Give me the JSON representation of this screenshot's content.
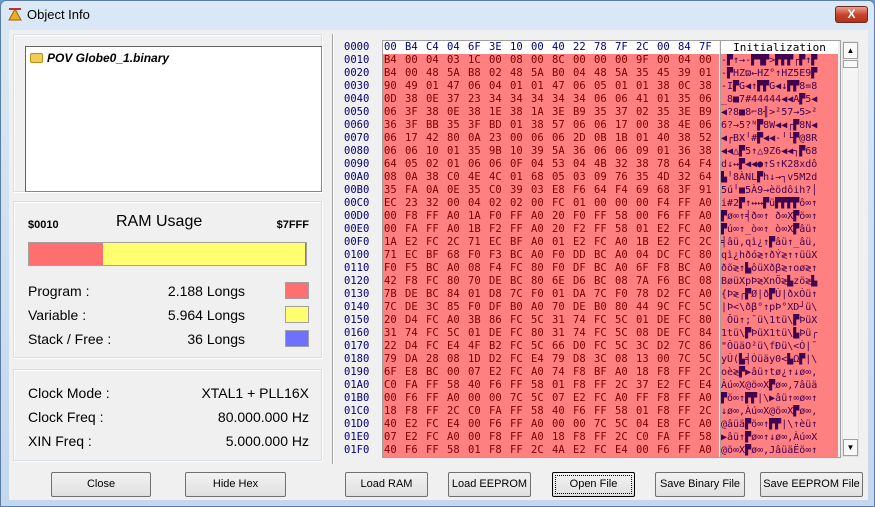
{
  "window": {
    "title": "Object Info",
    "close": "X"
  },
  "tree": {
    "file": "POV Globe0_1.binary"
  },
  "ram": {
    "title": "RAM Usage",
    "start": "$0010",
    "end": "$7FFF",
    "program_label": "Program :",
    "program_value": "2.188 Longs",
    "variable_label": "Variable :",
    "variable_value": "5.964 Longs",
    "stack_label": "Stack / Free :",
    "stack_value": "36 Longs",
    "program_longs": 2188,
    "variable_longs": 5964,
    "stack_longs": 36,
    "colors": {
      "program": "#ff6f6f",
      "variable": "#ffff70",
      "stack": "#7070ff"
    }
  },
  "clock": {
    "mode_label": "Clock Mode :",
    "mode_value": "XTAL1 + PLL16X",
    "freq_label": "Clock Freq :",
    "freq_value": "80.000.000 Hz",
    "xin_label": "XIN Freq :",
    "xin_value": "5.000.000 Hz"
  },
  "hex": {
    "rows": [
      [
        "0000",
        "00 B4 C4 04 6F 3E 10 00 40 22 78 7F 2C 00 84 7F",
        "Initialization"
      ],
      [
        "0010",
        "B4 00 04 03 1C 00 08 00 8C 00 00 00 9F 00 04 00",
        "-▛↑→-▛▜▛>▛▛▛┌▛↑▛"
      ],
      [
        "0020",
        "B4 00 48 5A B8 02 48 5A B0 04 48 5A 35 45 39 01",
        "-▛HZϖ←HZ°↑HZ5E9▛"
      ],
      [
        "0030",
        "90 49 01 47 06 04 01 01 47 06 05 01 01 38 0C 38",
        "-I▛G◀↑▛▛G◀↓▛▛8=8"
      ],
      [
        "0040",
        "0D 38 0E 37 23 34 34 34 34 34 06 06 41 01 35 06",
        "_8■7#44444◀◀A▛5◀"
      ],
      [
        "0050",
        "06 3F 38 0E 38 1E 38 1A 3E B9 35 37 02 35 3E B9",
        "◀?8■8⌐8╢>²57→5>²"
      ],
      [
        "0060",
        "36 3F BB 35 3F BD 01 38 57 06 06 17 00 38 4E 06",
        "6?→5?ᴺ▛8W◀◀┌▛8N◀"
      ],
      [
        "0070",
        "06 17 42 80 0A 23 00 06 06 2D 0B 1B 01 40 38 52",
        "◀┌BX╵#▛◀◀-╵└▛@8R"
      ],
      [
        "0080",
        "06 06 10 01 35 9B 10 39 5A 36 06 06 09 01 36 38",
        "◀◀△▛5↑△9Z6◀◀┐▛68"
      ],
      [
        "0090",
        "64 05 02 01 06 06 0F 04 53 04 4B 32 38 78 64 F4",
        "d↓↔▛◀◀●↑S↑K28xdô"
      ],
      [
        "00A0",
        "08 0A 38 C0 4E 4C 01 68 05 03 09 76 35 4D 32 64",
        "▙╵8ÀNL▛h↓→┐v5M2d"
      ],
      [
        "00B0",
        "35 FA 0A 0E 35 C0 39 03 E8 F6 64 F4 69 68 3F 91",
        "5ú╵■5À9→èödôih?│"
      ],
      [
        "00C0",
        "EC 23 32 00 04 02 02 00 FC 01 00 00 00 F4 FF A0",
        "i#2▛↑↔↔▛ü▛▛▛▛ô∞↑"
      ],
      [
        "00D0",
        "00 F8 FF A0 1A F0 FF A0 20 F0 FF 58 00 F6 FF A0",
        "▛ø∞↑╡ð∞↑ ð∞X▛ö∞↑"
      ],
      [
        "00E0",
        "00 FA FF A0 1B F2 FF A0 20 F2 FF 58 01 E2 FC A0",
        "▛ú∞↑_ò∞↑ ò∞X▛âü↑"
      ],
      [
        "00F0",
        "1A E2 FC 2C 71 EC BF A0 01 E2 FC A0 1B E2 FC 2C",
        "╡âü,qì¿↑▛âü↑_âü,"
      ],
      [
        "0100",
        "71 EC BF 68 F0 F3 BC A0 F0 DD BC A0 04 DC FC 80",
        "qì¿hðó≷↑ðÝ≷↑↑üüX"
      ],
      [
        "0110",
        "F0 F5 BC A0 08 F4 FC 80 F0 DF BC A0 6F F8 BC A0",
        "ðõ≷↑▙ôüXðβ≷↑oø≷↑"
      ],
      [
        "0120",
        "42 F8 FC 80 70 DE BC 80 6E D6 BC 08 7A F6 BC 08",
        "BøüXpÞ≷XnÖ≷▙zö≷▙"
      ],
      [
        "0130",
        "7B DE BC 84 01 D8 7C F0 01 DA 7C F0 78 D2 FC A0",
        "{Þ≷╭▛Ø|ð▛Ú|ðxÒü↑"
      ],
      [
        "0140",
        "7C DE 3C 85 F0 DF B0 A0 70 DE B0 80 44 9C FC 5C",
        "|Þ<\\ðβ°↑pÞ°XD┘ü\\"
      ],
      [
        "0150",
        "20 D4 FC A0 3B 86 FC 5C 31 74 FC 5C 01 DE FC 80",
        " Ôü↑;¯ü\\1tü\\▛ÞüX"
      ],
      [
        "0160",
        "31 74 FC 5C 01 DE FC 80 31 74 FC 5C 08 DE FC 84",
        "1tü\\▛ÞüX1tü\\▙Þü╭"
      ],
      [
        "0170",
        "22 D4 FC E4 4F B2 FC 5C 66 D0 FC 5C 3C D2 7C 86",
        "\"ÔüäO²ü\\fÐü\\<Ò|¯"
      ],
      [
        "0180",
        "79 DA 28 08 1D D2 FC E4 79 D8 3C 08 13 00 7C 5C",
        "yÚ(▙╡Òüäy0<▙Ω▛|\\"
      ],
      [
        "0190",
        "6F E8 BC 00 07 E2 FC A0 74 F8 BF A0 18 F8 FF 2C",
        "oè≷▛▶âü↑tø¿↑↓ø∞,"
      ],
      [
        "01A0",
        "C0 FA FF 58 40 F6 FF 58 01 F8 FF 2C 37 E2 FC E4",
        "Àú∞X@ö∞X▛ø∞,7âüä"
      ],
      [
        "01B0",
        "00 F6 FF A0 00 00 7C 5C 07 E2 FC A0 FF F8 FF A0",
        "▛ö∞↑▛▛|\\▶âü↑∞ø∞↑"
      ],
      [
        "01C0",
        "18 F8 FF 2C C0 FA FF 58 40 F6 FF 58 01 F8 FF 2C",
        "↓ø∞,Àú∞X@ö∞X▛ø∞,"
      ],
      [
        "01D0",
        "40 E2 FC E4 00 F6 FF A0 00 00 7C 5C 04 E8 FC A0",
        "@âüä▛ö∞↑▛▛|\\↑èü↑"
      ],
      [
        "01E0",
        "07 E2 FC A0 00 F8 FF A0 18 F8 FF 2C C0 FA FF 58",
        "▶âü↑▛ø∞↑↓ø∞,Àú∞X"
      ],
      [
        "01F0",
        "40 F6 FF 58 01 F8 FF 2C 4A E2 FC E4 00 F6 FF A0",
        "@ö∞X▛ø∞,JâüäЁö∞↑"
      ]
    ]
  },
  "buttons": {
    "close": "Close",
    "hide_hex": "Hide Hex",
    "load_ram": "Load RAM",
    "load_eeprom": "Load EEPROM",
    "open_file": "Open File",
    "save_binary": "Save Binary File",
    "save_eeprom": "Save EEPROM File"
  }
}
